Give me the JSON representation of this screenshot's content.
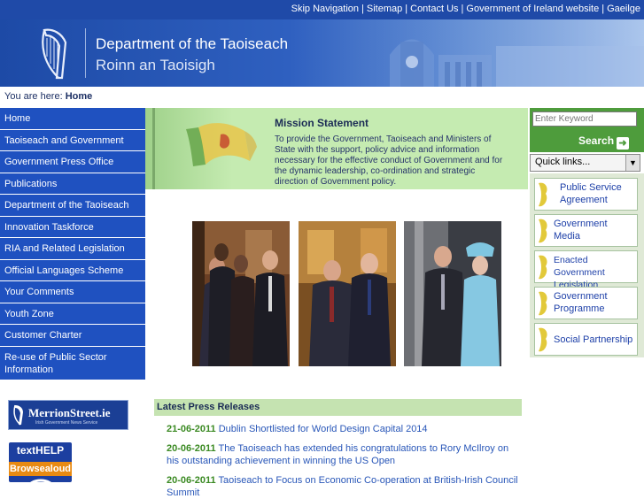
{
  "topbar": {
    "links": [
      "Skip Navigation",
      "Sitemap",
      "Contact Us",
      "Government of Ireland website",
      "Gaeilge"
    ]
  },
  "banner": {
    "title_en": "Department of the Taoiseach",
    "title_ga": "Roinn an Taoisigh"
  },
  "breadcrumb": {
    "prefix": "You are here:",
    "current": "Home"
  },
  "leftnav": {
    "items": [
      "Home",
      "Taoiseach and Government",
      "Government Press Office",
      "Publications",
      "Department of the Taoiseach",
      "Innovation Taskforce",
      "RIA and Related Legislation",
      "Official Languages Scheme",
      "Your Comments",
      "Youth Zone",
      "Customer Charter",
      "Re-use of Public Sector Information"
    ]
  },
  "badges": {
    "merrion": "MerrionStreet.ie",
    "merrion_sub": "Irish Government News Service",
    "texthelp_top": "textHELP",
    "texthelp_bottom": "Browsealoud"
  },
  "mission": {
    "title": "Mission Statement",
    "text": "To provide the Government, Taoiseach and Ministers of State with the support, policy advice and information necessary for the effective conduct of Government and for the dynamic leadership, co-ordination and strategic direction of Government policy."
  },
  "press": {
    "header": "Latest Press Releases",
    "items": [
      {
        "date": "21-06-2011",
        "title": "Dublin Shortlisted for World Design Capital 2014"
      },
      {
        "date": "20-06-2011",
        "title": "The Taoiseach has extended his congratulations to Rory McIlroy on his outstanding achievement in winning the US Open"
      },
      {
        "date": "20-06-2011",
        "title": "Taoiseach to Focus on Economic Co-operation at British-Irish Council Summit"
      }
    ]
  },
  "search": {
    "placeholder": "Enter Keyword",
    "button_label": "Search",
    "quicklinks_label": "Quick links..."
  },
  "sidelinks": [
    "Public Service Agreement",
    "Government Media",
    "Enacted Government Legislation",
    "Government Programme",
    "Social Partnership"
  ],
  "colors": {
    "nav_blue": "#1f51c0",
    "banner_blue": "#1f4aa8",
    "mission_green": "#c5ebb1",
    "search_green": "#4e9c3c",
    "date_green": "#3b8a23",
    "link_blue": "#2856b8"
  }
}
